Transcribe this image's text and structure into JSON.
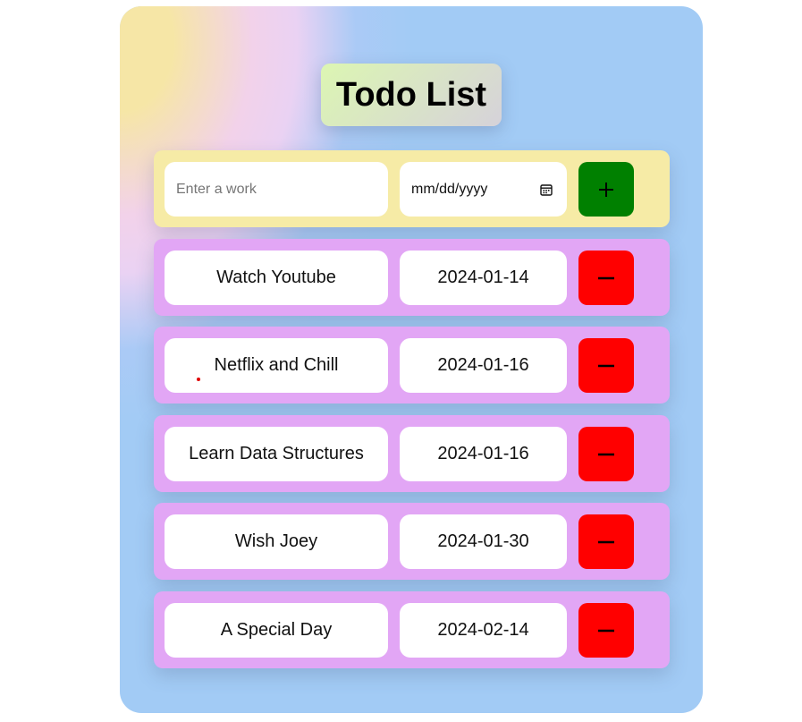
{
  "app": {
    "title": "Todo List"
  },
  "input_row": {
    "work_placeholder": "Enter a work",
    "date_placeholder": "mm/dd/yyyy",
    "add_icon": "plus-icon",
    "calendar_icon": "calendar-icon"
  },
  "todos": [
    {
      "name": "Watch Youtube",
      "date": "2024-01-14"
    },
    {
      "name": "Netflix and Chill",
      "date": "2024-01-16"
    },
    {
      "name": "Learn Data Structures",
      "date": "2024-01-16"
    },
    {
      "name": "Wish Joey",
      "date": "2024-01-30"
    },
    {
      "name": "A Special Day",
      "date": "2024-02-14"
    }
  ],
  "colors": {
    "input_row_bg": "#f6eba6",
    "todo_row_bg": "#e2a6f5",
    "add_button": "#008000",
    "delete_button": "#ff0000",
    "card_bg": "#a2cbf5"
  },
  "icons": {
    "delete": "minus-icon"
  }
}
